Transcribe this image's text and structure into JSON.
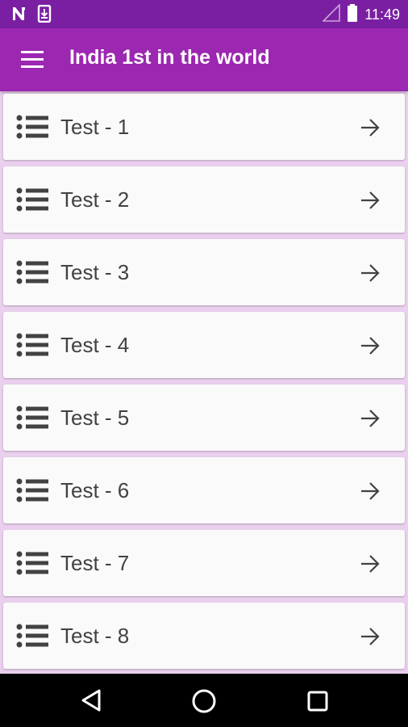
{
  "status_bar": {
    "time": "11:49",
    "icons": [
      "n-notification-icon",
      "download-notification-icon",
      "signal-icon",
      "battery-icon"
    ]
  },
  "app_bar": {
    "title": "India 1st in the world",
    "menu_icon": "hamburger-menu-icon"
  },
  "tests": [
    {
      "label": "Test - 1"
    },
    {
      "label": "Test - 2"
    },
    {
      "label": "Test - 3"
    },
    {
      "label": "Test - 4"
    },
    {
      "label": "Test - 5"
    },
    {
      "label": "Test - 6"
    },
    {
      "label": "Test - 7"
    },
    {
      "label": "Test - 8"
    }
  ],
  "nav_bar": {
    "buttons": [
      "back-icon",
      "home-icon",
      "recents-icon"
    ]
  },
  "colors": {
    "status_bar": "#7a1fa2",
    "app_bar": "#9c27b0",
    "background": "#ead0ee",
    "card": "#fafafa"
  }
}
